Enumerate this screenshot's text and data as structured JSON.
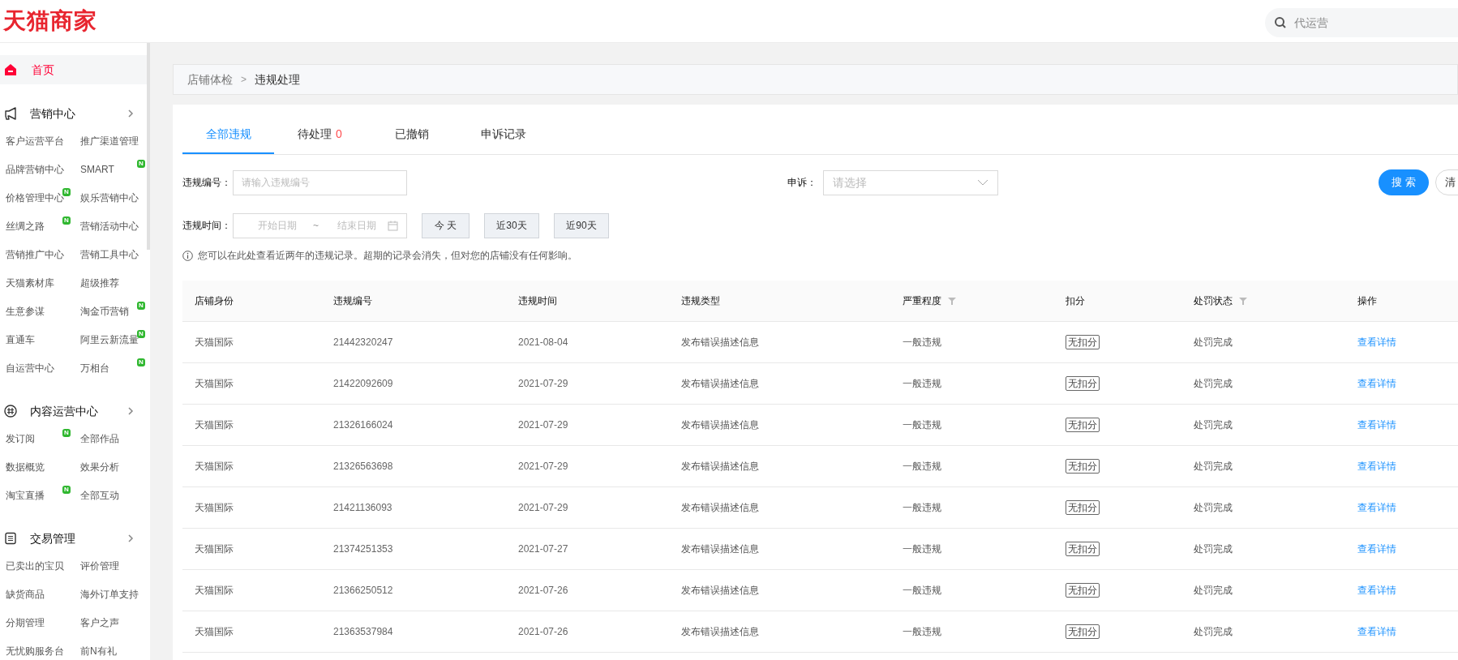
{
  "header": {
    "logo": "天猫商家",
    "search": {
      "placeholder": "代运营"
    }
  },
  "sidebar": {
    "home": {
      "label": "首页",
      "selected": true
    },
    "sections": [
      {
        "title": "营销中心",
        "items": [
          {
            "label": "客户运营平台"
          },
          {
            "label": "推广渠道管理"
          },
          {
            "label": "品牌营销中心"
          },
          {
            "label": "SMART",
            "badge": "N"
          },
          {
            "label": "价格管理中心",
            "badge": "N"
          },
          {
            "label": "娱乐营销中心"
          },
          {
            "label": "丝绸之路",
            "badge": "N"
          },
          {
            "label": "营销活动中心"
          },
          {
            "label": "营销推广中心"
          },
          {
            "label": "营销工具中心"
          },
          {
            "label": "天猫素材库"
          },
          {
            "label": "超级推荐"
          },
          {
            "label": "生意参谋"
          },
          {
            "label": "淘金币营销",
            "badge": "N"
          },
          {
            "label": "直通车"
          },
          {
            "label": "阿里云新流量",
            "badge": "N"
          },
          {
            "label": "自运营中心"
          },
          {
            "label": "万相台",
            "badge": "N"
          }
        ]
      },
      {
        "title": "内容运营中心",
        "items": [
          {
            "label": "发订阅",
            "badge": "N"
          },
          {
            "label": "全部作品"
          },
          {
            "label": "数据概览"
          },
          {
            "label": "效果分析"
          },
          {
            "label": "淘宝直播",
            "badge": "N"
          },
          {
            "label": "全部互动"
          }
        ]
      },
      {
        "title": "交易管理",
        "items": [
          {
            "label": "已卖出的宝贝"
          },
          {
            "label": "评价管理"
          },
          {
            "label": "缺货商品"
          },
          {
            "label": "海外订单支持"
          },
          {
            "label": "分期管理"
          },
          {
            "label": "客户之声"
          },
          {
            "label": "无忧购服务台"
          },
          {
            "label": "前N有礼"
          }
        ]
      }
    ]
  },
  "breadcrumb": {
    "separator": ">",
    "items": [
      {
        "label": "店铺体检"
      },
      {
        "label": "违规处理"
      }
    ]
  },
  "tabs": [
    {
      "label": "全部违规",
      "selected": true
    },
    {
      "label": "待处理",
      "count": "0",
      "selected": false
    },
    {
      "label": "已撤销",
      "selected": false
    },
    {
      "label": "申诉记录",
      "selected": false
    }
  ],
  "filters": {
    "violation_no": {
      "label": "违规编号：",
      "placeholder": "请输入违规编号"
    },
    "appeal": {
      "label": "申诉：",
      "placeholder": "请选择"
    },
    "time": {
      "label": "违规时间：",
      "start_placeholder": "开始日期",
      "separator": "~",
      "end_placeholder": "结束日期"
    },
    "quick_ranges": [
      "今 天",
      "近30天",
      "近90天"
    ],
    "search_button": "搜 索",
    "clear_button": "清"
  },
  "notice": "您可以在此处查看近两年的违规记录。超期的记录会消失，但对您的店铺没有任何影响。",
  "table": {
    "columns": [
      {
        "label": "店铺身份"
      },
      {
        "label": "违规编号"
      },
      {
        "label": "违规时间"
      },
      {
        "label": "违规类型"
      },
      {
        "label": "严重程度",
        "filter": true
      },
      {
        "label": "扣分"
      },
      {
        "label": "处罚状态",
        "filter": true
      },
      {
        "label": "操作"
      }
    ],
    "rows": [
      [
        "天猫国际",
        "21442320247",
        "2021-08-04",
        "发布错误描述信息",
        "一般违规",
        "无扣分",
        "处罚完成",
        "查看详情"
      ],
      [
        "天猫国际",
        "21422092609",
        "2021-07-29",
        "发布错误描述信息",
        "一般违规",
        "无扣分",
        "处罚完成",
        "查看详情"
      ],
      [
        "天猫国际",
        "21326166024",
        "2021-07-29",
        "发布错误描述信息",
        "一般违规",
        "无扣分",
        "处罚完成",
        "查看详情"
      ],
      [
        "天猫国际",
        "21326563698",
        "2021-07-29",
        "发布错误描述信息",
        "一般违规",
        "无扣分",
        "处罚完成",
        "查看详情"
      ],
      [
        "天猫国际",
        "21421136093",
        "2021-07-29",
        "发布错误描述信息",
        "一般违规",
        "无扣分",
        "处罚完成",
        "查看详情"
      ],
      [
        "天猫国际",
        "21374251353",
        "2021-07-27",
        "发布错误描述信息",
        "一般违规",
        "无扣分",
        "处罚完成",
        "查看详情"
      ],
      [
        "天猫国际",
        "21366250512",
        "2021-07-26",
        "发布错误描述信息",
        "一般违规",
        "无扣分",
        "处罚完成",
        "查看详情"
      ],
      [
        "天猫国际",
        "21363537984",
        "2021-07-26",
        "发布错误描述信息",
        "一般违规",
        "无扣分",
        "处罚完成",
        "查看详情"
      ]
    ]
  }
}
